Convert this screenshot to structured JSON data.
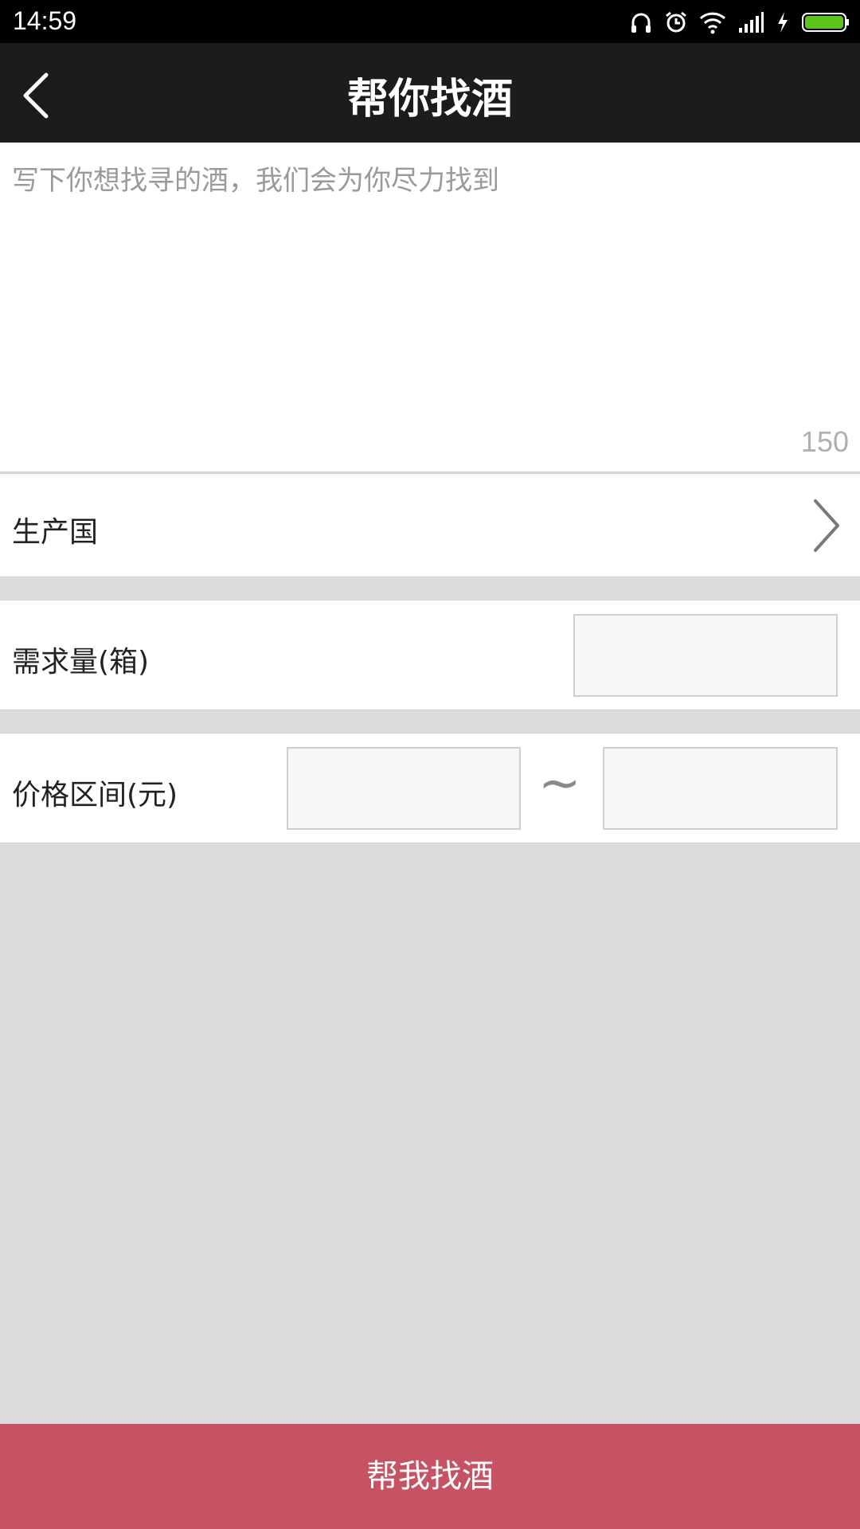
{
  "status_bar": {
    "time": "14:59",
    "icons": [
      "headphones-icon",
      "alarm-icon",
      "wifi-icon",
      "signal-icon",
      "charging-icon",
      "battery-icon"
    ]
  },
  "header": {
    "title": "帮你找酒",
    "back_icon": "back-chevron-icon"
  },
  "description": {
    "placeholder": "写下你想找寻的酒，我们会为你尽力找到",
    "char_limit": "150"
  },
  "form": {
    "country_label": "生产国",
    "quantity_label": "需求量(箱)",
    "price_label": "价格区间(元)",
    "price_separator": "~"
  },
  "submit": {
    "label": "帮我找酒",
    "color": "#c65263"
  },
  "colors": {
    "status_bar": "#000000",
    "nav_bar": "#1c1c1c",
    "background": "#dcdcdc",
    "battery": "#5ec41b"
  }
}
